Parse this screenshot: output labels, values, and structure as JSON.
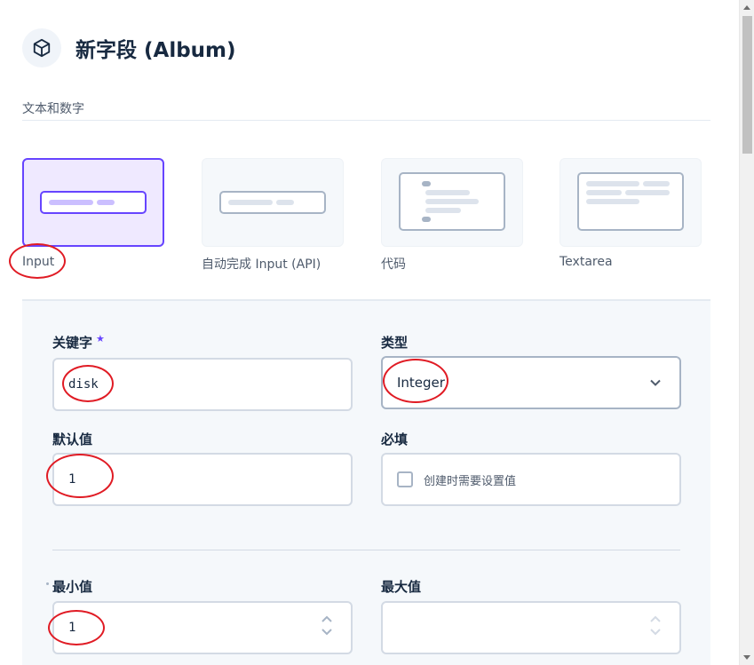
{
  "header": {
    "icon": "box-icon",
    "title": "新字段 (Album)"
  },
  "interface_group": {
    "label": "文本和数字",
    "options": [
      {
        "label": "Input",
        "selected": true,
        "icon": "input-preview-icon"
      },
      {
        "label": "自动完成 Input (API)",
        "selected": false,
        "icon": "autocomplete-preview-icon"
      },
      {
        "label": "代码",
        "selected": false,
        "icon": "code-preview-icon"
      },
      {
        "label": "Textarea",
        "selected": false,
        "icon": "textarea-preview-icon"
      }
    ]
  },
  "form": {
    "key": {
      "label": "关键字",
      "required_marker": "★",
      "value": "disk"
    },
    "type": {
      "label": "类型",
      "value": "Integer"
    },
    "default_value": {
      "label": "默认值",
      "value": "1"
    },
    "required": {
      "label": "必填",
      "checkbox_label": "创建时需要设置值",
      "checked": false
    },
    "min": {
      "label": "最小值",
      "value": "1"
    },
    "max": {
      "label": "最大值",
      "value": ""
    }
  },
  "colors": {
    "accent": "#6644ff",
    "annotation": "#e01b24",
    "panel_bg": "#f5f8fb"
  }
}
